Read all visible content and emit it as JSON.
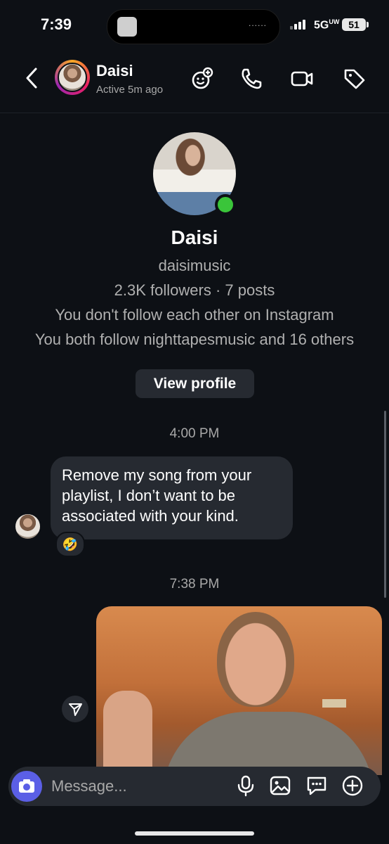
{
  "status_bar": {
    "time": "7:39",
    "network": "5G",
    "network_suffix": "UW",
    "battery": "51",
    "island_dots": "......"
  },
  "header": {
    "name": "Daisi",
    "status": "Active 5m ago",
    "icons": [
      "back-chevron-icon",
      "effects-icon",
      "phone-icon",
      "video-icon",
      "tag-icon"
    ]
  },
  "profile": {
    "name": "Daisi",
    "username": "daisimusic",
    "stats": "2.3K followers · 7 posts",
    "follow_note": "You don't follow each other on Instagram",
    "mutual_note": "You both follow nighttapesmusic and 16 others",
    "view_profile_label": "View profile",
    "online": true
  },
  "thread": {
    "timestamp_1": "4:00 PM",
    "message_1": "Remove my song from your playlist, I don’t want to be associated with your kind.",
    "reaction_1": "🤣",
    "timestamp_2": "7:38 PM"
  },
  "composer": {
    "placeholder": "Message...",
    "icons": [
      "camera-icon",
      "microphone-icon",
      "gallery-icon",
      "sticker-icon",
      "plus-icon"
    ]
  },
  "colors": {
    "background": "#0d1015",
    "bubble": "#262a31",
    "online": "#3ac53a",
    "camera": "#5b5fe6"
  }
}
